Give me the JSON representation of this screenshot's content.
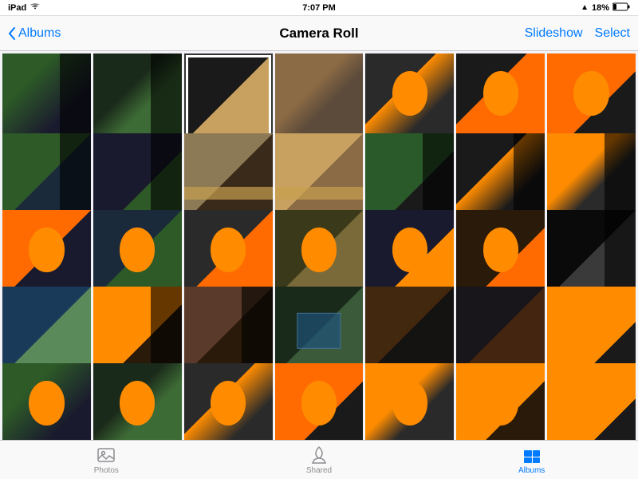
{
  "statusBar": {
    "left": "iPad",
    "time": "7:07 PM",
    "battery": "18%",
    "wifiIcon": "wifi",
    "batteryIcon": "battery"
  },
  "navBar": {
    "backLabel": "Albums",
    "title": "Camera Roll",
    "slideshowLabel": "Slideshow",
    "selectLabel": "Select"
  },
  "tabs": [
    {
      "id": "photos",
      "label": "Photos",
      "active": false
    },
    {
      "id": "shared",
      "label": "Shared",
      "active": false
    },
    {
      "id": "albums",
      "label": "Albums",
      "active": true
    }
  ],
  "photos": {
    "count": 35,
    "colorClasses": [
      "c1",
      "c2",
      "c3",
      "c4",
      "c5",
      "c6",
      "c7",
      "c8",
      "c9",
      "c10",
      "c11",
      "c12",
      "c13",
      "c14",
      "c15",
      "c16",
      "c17",
      "c18",
      "c19",
      "c20",
      "c21",
      "c22",
      "c23",
      "c24",
      "c25",
      "c26",
      "c27",
      "c28",
      "c1",
      "c2",
      "c5",
      "c7",
      "c14",
      "c23",
      "c28"
    ]
  }
}
